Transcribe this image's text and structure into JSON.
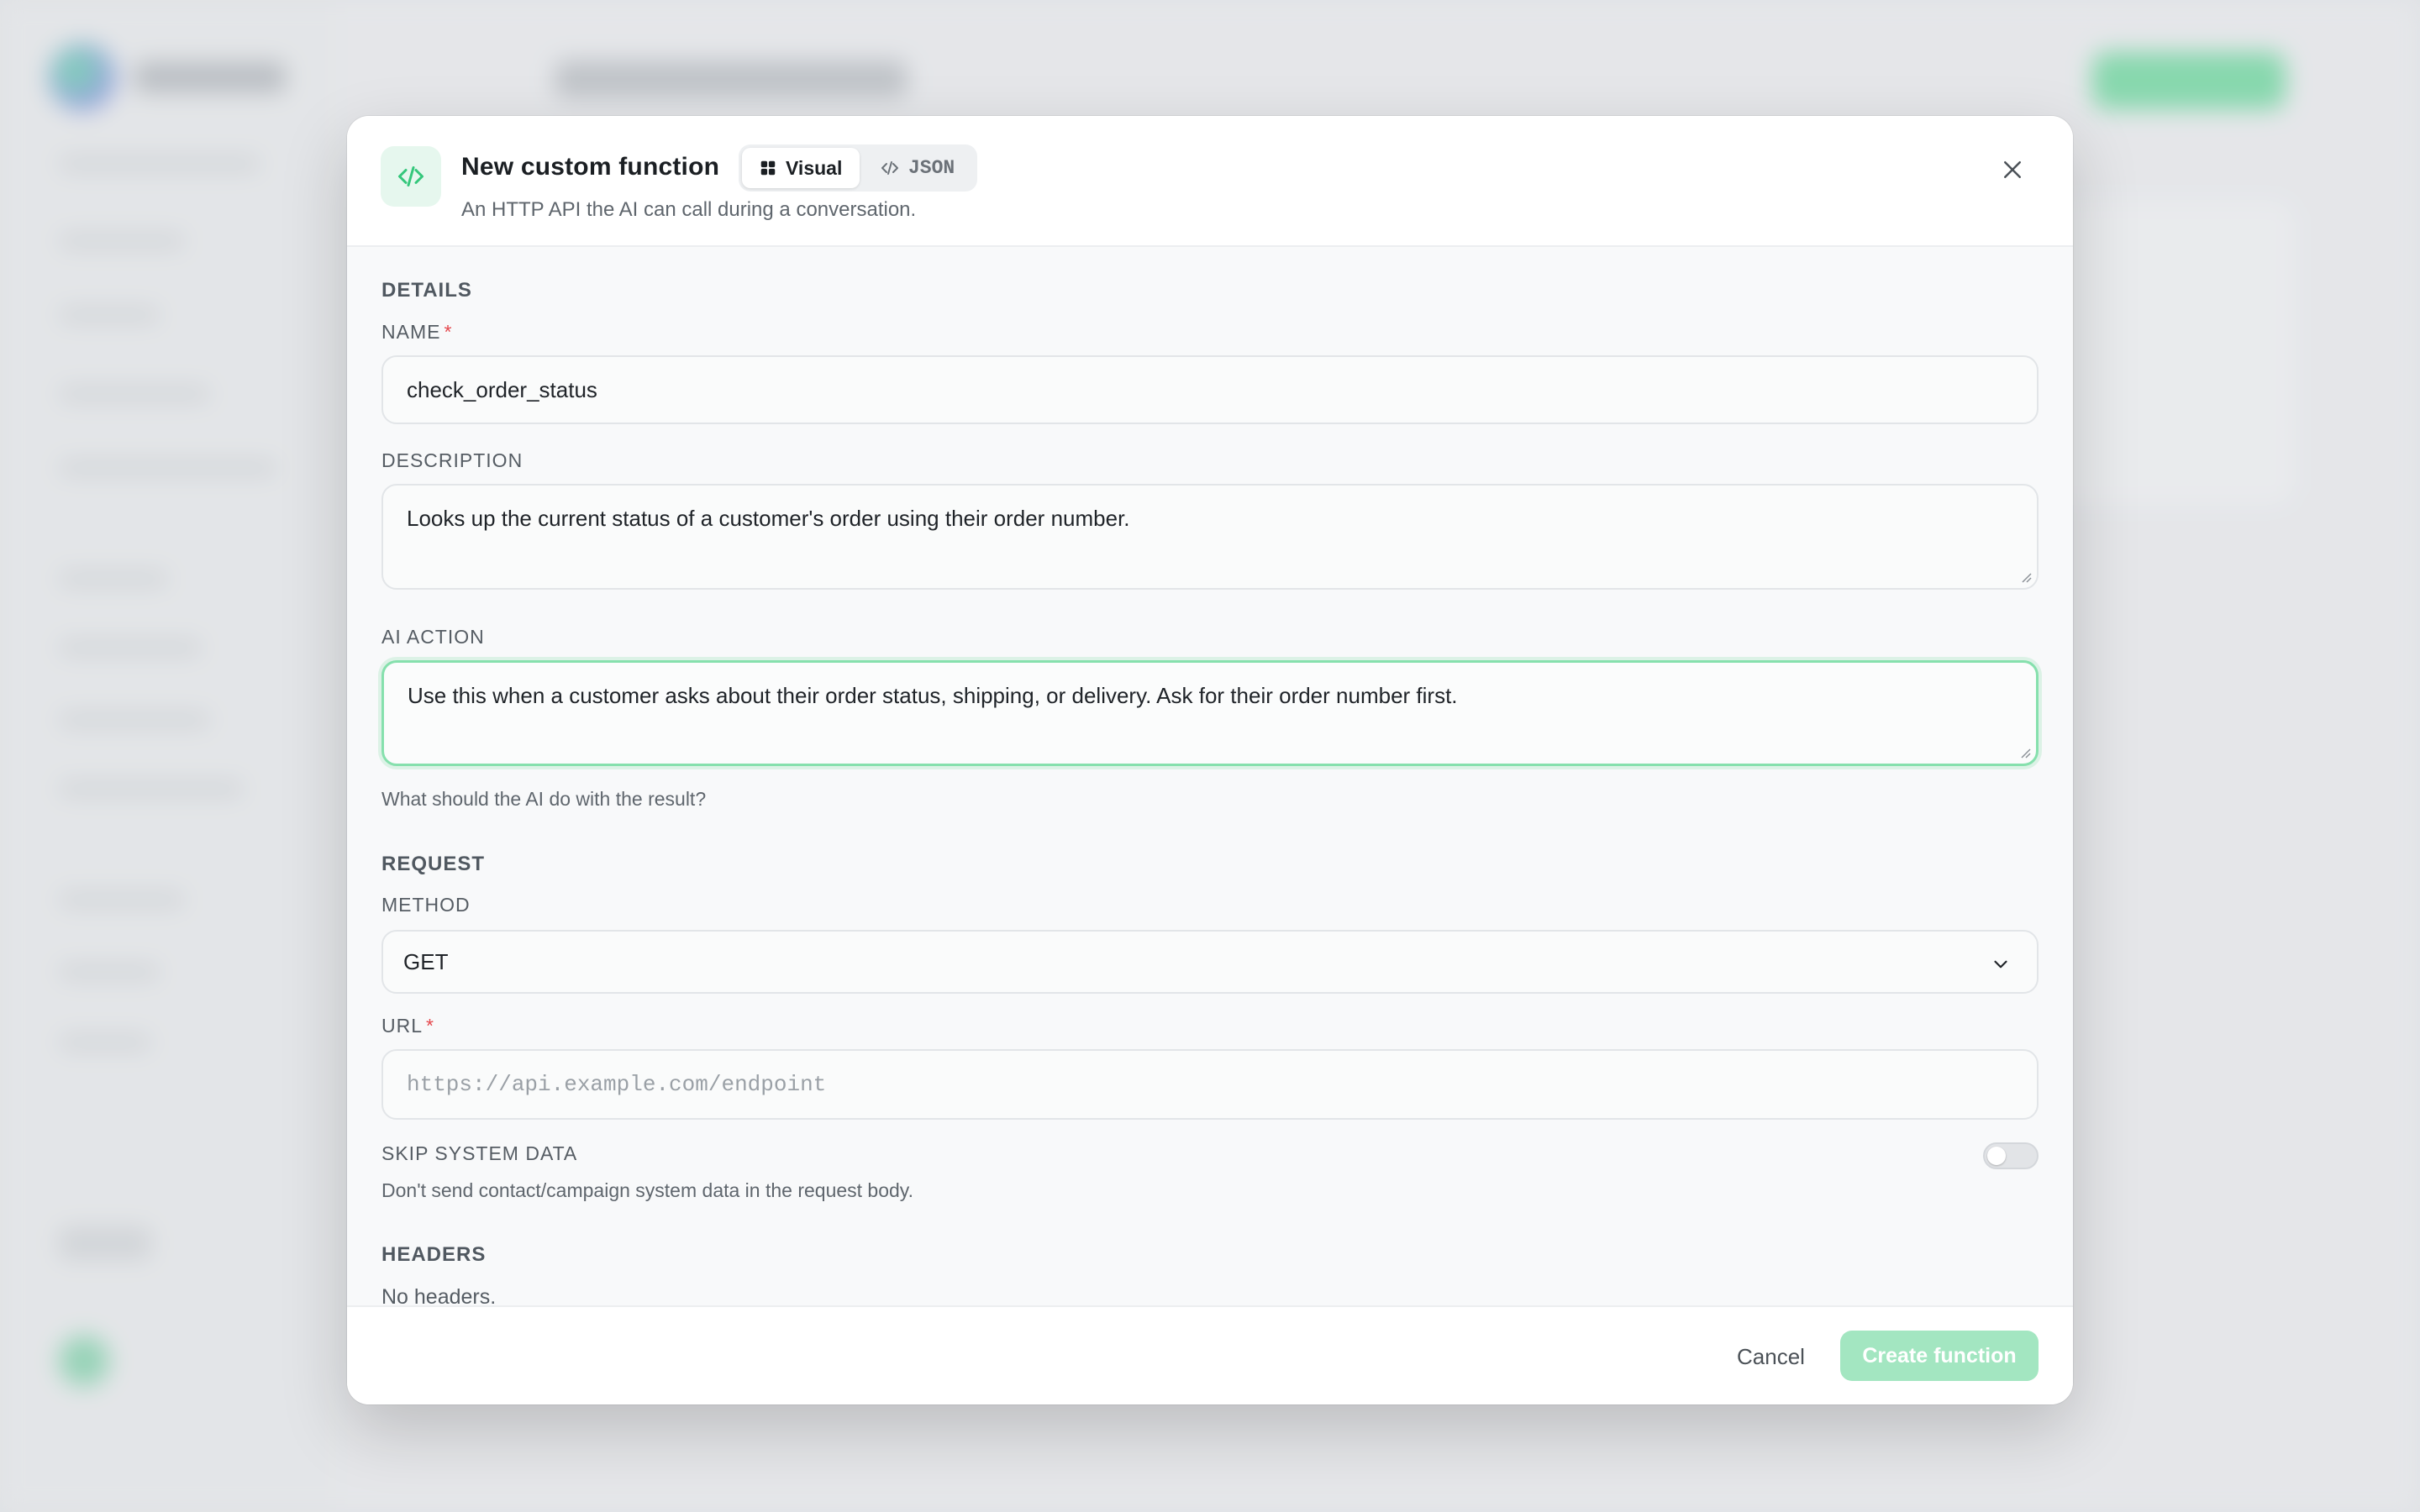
{
  "modal": {
    "title": "New custom function",
    "subtitle": "An HTTP API the AI can call during a conversation.",
    "icon": "code-icon",
    "view_toggle": {
      "visual_label": "Visual",
      "json_label": "JSON",
      "selected": "Visual"
    }
  },
  "details": {
    "section_title": "DETAILS",
    "name": {
      "label": "NAME",
      "required_mark": "*",
      "value": "check_order_status"
    },
    "description": {
      "label": "DESCRIPTION",
      "value": "Looks up the current status of a customer's order using their order number."
    },
    "ai_action": {
      "label": "AI ACTION",
      "value": "Use this when a customer asks about their order status, shipping, or delivery. Ask for their order number first.",
      "helper": "What should the AI do with the result?"
    }
  },
  "request": {
    "section_title": "REQUEST",
    "method": {
      "label": "METHOD",
      "value": "GET"
    },
    "url": {
      "label": "URL",
      "required_mark": "*",
      "placeholder": "https://api.example.com/endpoint",
      "value": ""
    },
    "skip_system_data": {
      "label": "SKIP SYSTEM DATA",
      "helper": "Don't send contact/campaign system data in the request body.",
      "enabled": false
    }
  },
  "headers": {
    "section_title": "HEADERS",
    "empty_text": "No headers."
  },
  "footer": {
    "cancel_label": "Cancel",
    "create_label": "Create function"
  },
  "colors": {
    "accent": "#22c55e",
    "accent_disabled": "#a3e6c1",
    "focus_border": "#86e0ad",
    "required": "#e5484d"
  }
}
